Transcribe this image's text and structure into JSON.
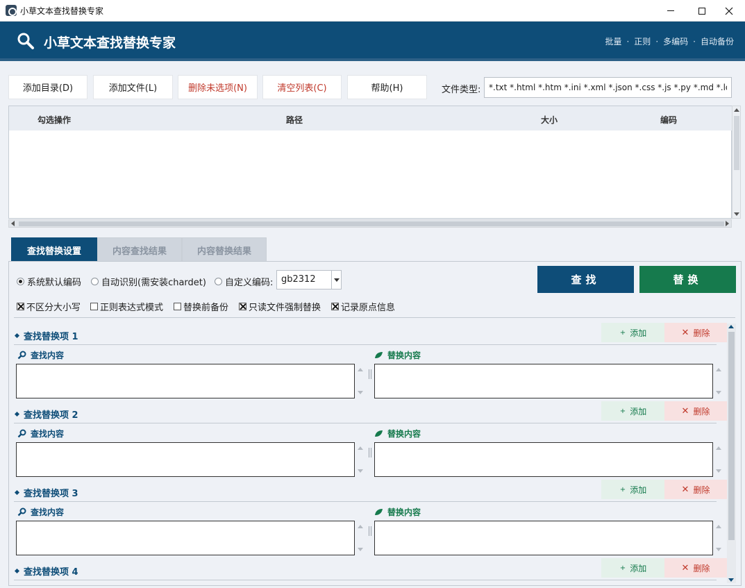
{
  "window": {
    "title": "小草文本查找替换专家"
  },
  "header": {
    "title": "小草文本查找替换专家",
    "tags": [
      "批量",
      "正则",
      "多编码",
      "自动备份"
    ]
  },
  "toolbar": {
    "buttons": [
      {
        "label": "添加目录(D)",
        "color": "#222222"
      },
      {
        "label": "添加文件(L)",
        "color": "#222222"
      },
      {
        "label": "删除未选项(N)",
        "color": "#c0392b"
      },
      {
        "label": "清空列表(C)",
        "color": "#c0392b"
      },
      {
        "label": "帮助(H)",
        "color": "#222222"
      }
    ],
    "filetype_label": "文件类型:",
    "filetype_value": "*.txt *.html *.htm *.ini *.xml *.json *.css *.js *.py *.md *.log *.c"
  },
  "filelist": {
    "columns": [
      "勾选操作",
      "路径",
      "大小",
      "编码"
    ],
    "rows": []
  },
  "tabs": [
    {
      "label": "查找替换设置",
      "active": true
    },
    {
      "label": "内容查找结果",
      "active": false
    },
    {
      "label": "内容替换结果",
      "active": false
    }
  ],
  "encoding": {
    "options": [
      {
        "label": "系统默认编码",
        "selected": true
      },
      {
        "label": "自动识别(需安装chardet)",
        "selected": false
      },
      {
        "label": "自定义编码:",
        "selected": false
      }
    ],
    "custom_value": "gb2312"
  },
  "actions": {
    "find_label": "查找",
    "replace_label": "替换",
    "find_color": "#0e4d78",
    "replace_color": "#167a4d"
  },
  "options": [
    {
      "label": "不区分大小写",
      "checked": true
    },
    {
      "label": "正则表达式模式",
      "checked": false
    },
    {
      "label": "替换前备份",
      "checked": false
    },
    {
      "label": "只读文件强制替换",
      "checked": true
    },
    {
      "label": "记录原点信息",
      "checked": true
    }
  ],
  "items": [
    {
      "title": "查找替换项 1",
      "add_label": "添加",
      "delete_label": "删除",
      "find_label": "查找内容",
      "replace_label": "替换内容",
      "find_value": "",
      "replace_value": ""
    },
    {
      "title": "查找替换项 2",
      "add_label": "添加",
      "delete_label": "删除",
      "find_label": "查找内容",
      "replace_label": "替换内容",
      "find_value": "",
      "replace_value": ""
    },
    {
      "title": "查找替换项 3",
      "add_label": "添加",
      "delete_label": "删除",
      "find_label": "查找内容",
      "replace_label": "替换内容",
      "find_value": "",
      "replace_value": ""
    },
    {
      "title": "查找替换项 4",
      "add_label": "添加",
      "delete_label": "删除"
    }
  ]
}
